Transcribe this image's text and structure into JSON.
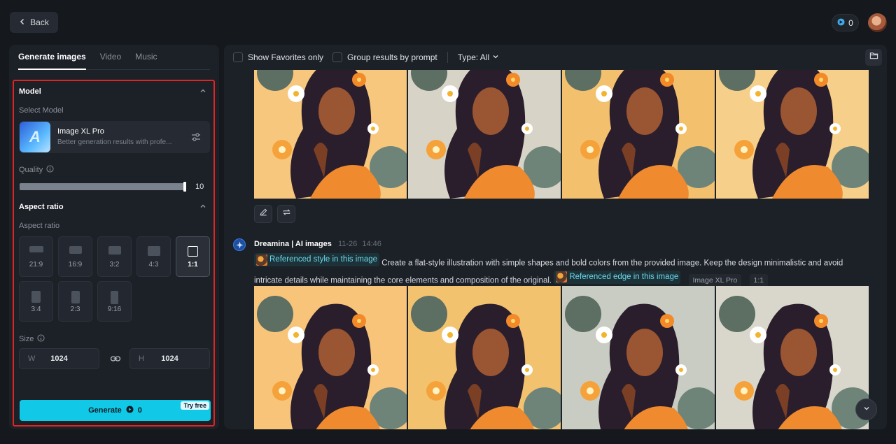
{
  "topbar": {
    "back_label": "Back",
    "credits": "0"
  },
  "left": {
    "tabs": [
      {
        "label": "Generate images",
        "active": true
      },
      {
        "label": "Video",
        "active": false
      },
      {
        "label": "Music",
        "active": false
      }
    ],
    "model_section": {
      "title": "Model",
      "select_label": "Select Model",
      "model_name": "Image XL Pro",
      "model_desc": "Better generation results with profe..."
    },
    "quality": {
      "label": "Quality",
      "value": "10",
      "fraction": 0.99
    },
    "aspect_section": {
      "title": "Aspect ratio",
      "sublabel": "Aspect ratio",
      "ratios": [
        "21:9",
        "16:9",
        "3:2",
        "4:3",
        "1:1",
        "3:4",
        "2:3",
        "9:16"
      ],
      "selected": "1:1"
    },
    "size": {
      "label": "Size",
      "w_prefix": "W",
      "w_value": "1024",
      "h_prefix": "H",
      "h_value": "1024"
    },
    "generate": {
      "label": "Generate",
      "cost": "0",
      "badge": "Try free"
    }
  },
  "right": {
    "filters": {
      "favorites_label": "Show Favorites only",
      "group_label": "Group results by prompt",
      "type_label": "Type: All"
    },
    "generation": {
      "author": "Dreamina | AI images",
      "date": "11-26",
      "time": "14:46",
      "ref_style": "Referenced style in this image",
      "prompt_text": "Create a flat-style illustration with simple shapes and bold colors from the provided image. Keep the design minimalistic and avoid intricate details while maintaining the core elements and composition of the original.",
      "ref_edge": "Referenced edge in this image",
      "model_tag": "Image XL Pro",
      "ratio_tag": "1:1"
    }
  },
  "colors": {
    "accent": "#11c9e6",
    "highlight_border": "#e02424",
    "panel_bg": "#1c2027",
    "page_bg": "#15181d"
  }
}
